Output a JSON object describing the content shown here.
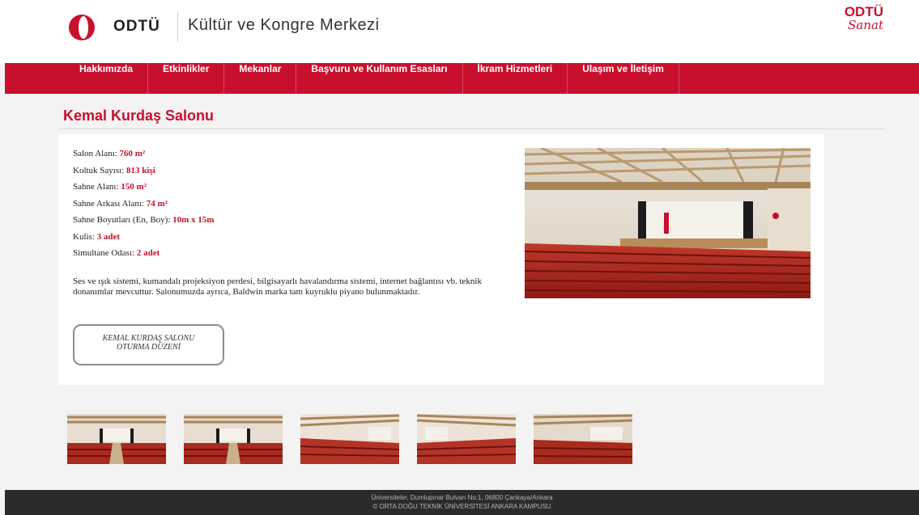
{
  "header": {
    "brand": "ODTÜ",
    "site_title": "Kültür ve Kongre Merkezi",
    "sanat_top": "ODTÜ",
    "sanat_bottom": "Sanat",
    "brand_color": "#c8102e"
  },
  "nav": {
    "items": [
      {
        "label": "Hakkımızda"
      },
      {
        "label": "Etkinlikler"
      },
      {
        "label": "Mekanlar"
      },
      {
        "label": "Başvuru ve Kullanım Esasları"
      },
      {
        "label": "İkram Hizmetleri"
      },
      {
        "label": "Ulaşım ve İletişim"
      }
    ]
  },
  "page": {
    "title": "Kemal Kurdaş Salonu",
    "specs": [
      {
        "label": "Salon Alanı: ",
        "value": "760 m²"
      },
      {
        "label": "Koltuk Sayısı: ",
        "value": "813  kişi"
      },
      {
        "label": "Sahne Alanı: ",
        "value": "150 m²"
      },
      {
        "label": "Sahne Arkası Alanı: ",
        "value": "74 m²"
      },
      {
        "label": "Sahne Boyutları (En, Boy): ",
        "value": "10m x 15m"
      },
      {
        "label": "Kulis: ",
        "value": "3 adet"
      },
      {
        "label": "Simultane Odası: ",
        "value": "2 adet"
      }
    ],
    "description": "Ses ve ışık sistemi, kumandalı projeksiyon perdesi, bilgisayarlı havalandırma sistemi, internet bağlantısı vb. teknik donanımlar mevcuttur. Salonumuzda ayrıca, Baldwin marka tam kuyruklu piyano bulunmaktadır.",
    "seating_button": {
      "line1": "KEMAL KURDAŞ SALONU",
      "line2": "OTURMA DÜZENİ"
    },
    "thumbnails": [
      {
        "icon": "auditorium-photo-thumbnail"
      },
      {
        "icon": "auditorium-photo-thumbnail"
      },
      {
        "icon": "auditorium-photo-thumbnail"
      },
      {
        "icon": "auditorium-photo-thumbnail"
      },
      {
        "icon": "auditorium-photo-thumbnail"
      }
    ]
  },
  "footer": {
    "address": "Üniversiteler, Dumlupınar Bulvarı No:1, 06800 Çankaya/Ankara",
    "copyright": "© ORTA DOĞU TEKNİK ÜNİVERSİTESİ ANKARA KAMPUSU"
  }
}
